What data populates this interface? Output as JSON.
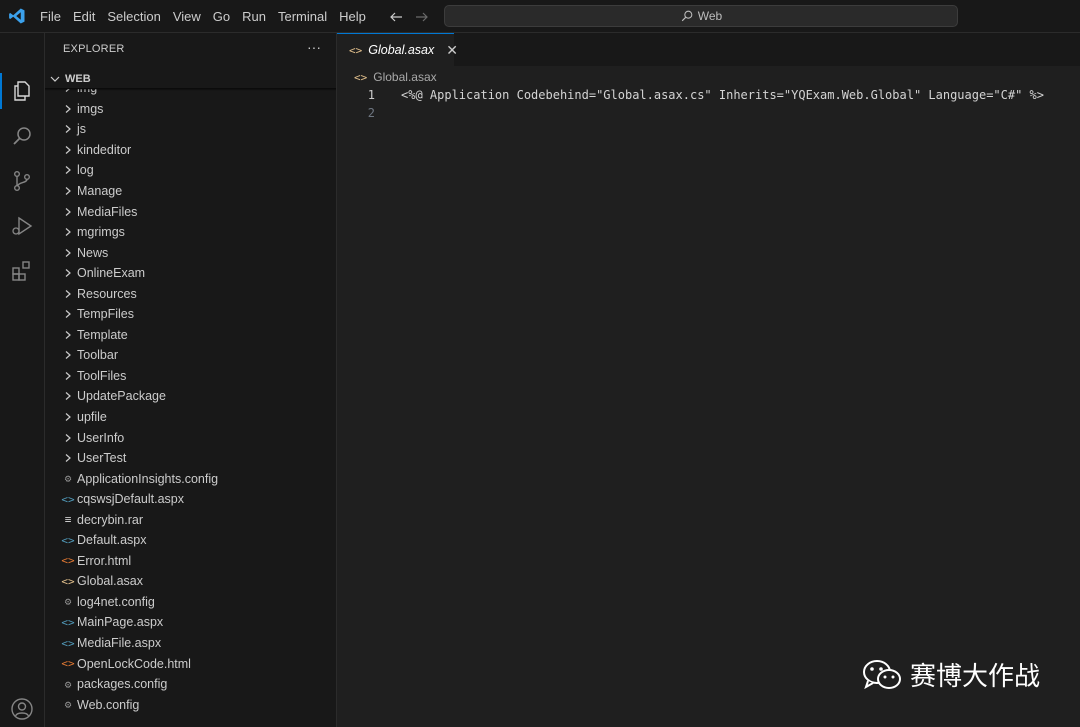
{
  "titlebar": {
    "menu": [
      "File",
      "Edit",
      "Selection",
      "View",
      "Go",
      "Run",
      "Terminal",
      "Help"
    ],
    "search_text": "Web"
  },
  "activity_bar": {
    "icons": [
      "explorer-icon",
      "search-icon",
      "source-control-icon",
      "run-debug-icon",
      "extensions-icon",
      "account-icon"
    ]
  },
  "sidebar": {
    "title": "EXPLORER",
    "more": "···",
    "root_label": "WEB",
    "items": [
      {
        "label": "img",
        "kind": "folder"
      },
      {
        "label": "imgs",
        "kind": "folder"
      },
      {
        "label": "js",
        "kind": "folder"
      },
      {
        "label": "kindeditor",
        "kind": "folder"
      },
      {
        "label": "log",
        "kind": "folder"
      },
      {
        "label": "Manage",
        "kind": "folder"
      },
      {
        "label": "MediaFiles",
        "kind": "folder"
      },
      {
        "label": "mgrimgs",
        "kind": "folder"
      },
      {
        "label": "News",
        "kind": "folder"
      },
      {
        "label": "OnlineExam",
        "kind": "folder"
      },
      {
        "label": "Resources",
        "kind": "folder"
      },
      {
        "label": "TempFiles",
        "kind": "folder"
      },
      {
        "label": "Template",
        "kind": "folder"
      },
      {
        "label": "Toolbar",
        "kind": "folder"
      },
      {
        "label": "ToolFiles",
        "kind": "folder"
      },
      {
        "label": "UpdatePackage",
        "kind": "folder"
      },
      {
        "label": "upfile",
        "kind": "folder"
      },
      {
        "label": "UserInfo",
        "kind": "folder"
      },
      {
        "label": "UserTest",
        "kind": "folder"
      },
      {
        "label": "ApplicationInsights.config",
        "kind": "config"
      },
      {
        "label": "cqswsjDefault.aspx",
        "kind": "aspx"
      },
      {
        "label": "decrybin.rar",
        "kind": "text"
      },
      {
        "label": "Default.aspx",
        "kind": "aspx"
      },
      {
        "label": "Error.html",
        "kind": "html"
      },
      {
        "label": "Global.asax",
        "kind": "asax"
      },
      {
        "label": "log4net.config",
        "kind": "config"
      },
      {
        "label": "MainPage.aspx",
        "kind": "aspx"
      },
      {
        "label": "MediaFile.aspx",
        "kind": "aspx"
      },
      {
        "label": "OpenLockCode.html",
        "kind": "html"
      },
      {
        "label": "packages.config",
        "kind": "config"
      },
      {
        "label": "Web.config",
        "kind": "config"
      }
    ]
  },
  "editor": {
    "tab_label": "Global.asax",
    "breadcrumb": "Global.asax",
    "lines": [
      {
        "num": "1",
        "text": "<%@ Application Codebehind=\"Global.asax.cs\" Inherits=\"YQExam.Web.Global\" Language=\"C#\" %>"
      },
      {
        "num": "2",
        "text": ""
      }
    ]
  },
  "watermark": {
    "text": "赛博大作战"
  },
  "colors": {
    "accent": "#0078d4",
    "asax_icon": "#e2c08d",
    "aspx_icon": "#519aba",
    "html_icon": "#e37933",
    "config_icon": "#8c8c8c"
  }
}
